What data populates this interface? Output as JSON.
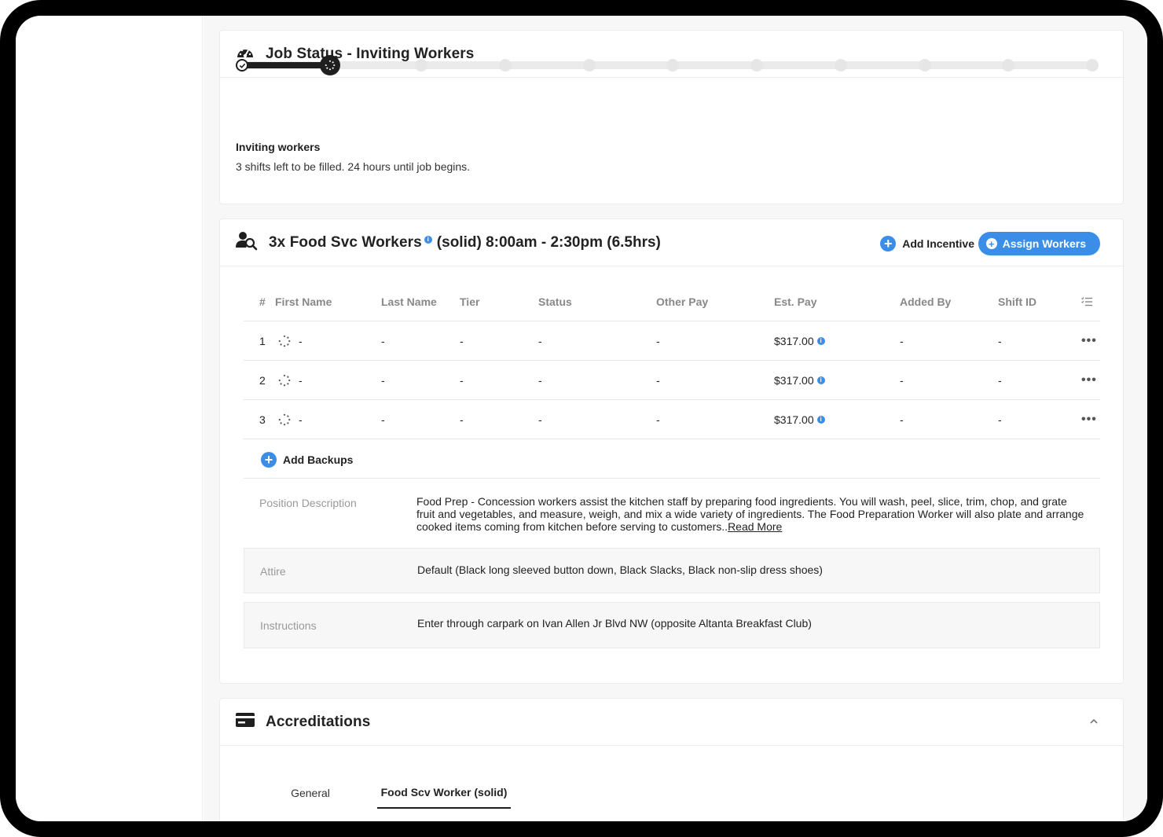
{
  "job_status": {
    "title": "Job Status - Inviting Workers",
    "heading": "Inviting workers",
    "text": "3 shifts left to be filled. 24 hours until job begins.",
    "steps_total": 11,
    "steps_completed": 1,
    "current_step": 2
  },
  "workers": {
    "title": "3x Food Svc Workers",
    "subtitle": "(solid) 8:00am - 2:30pm (6.5hrs)",
    "info": "i",
    "add_incentive_label": "Add Incentive",
    "assign_workers_label": "Assign Workers",
    "columns": [
      "#",
      "First Name",
      "Last Name",
      "Tier",
      "Status",
      "Other Pay",
      "Est. Pay",
      "Added By",
      "Shift ID"
    ],
    "rows": [
      {
        "num": "1",
        "first": "-",
        "last": "-",
        "tier": "-",
        "status": "-",
        "other": "-",
        "est": "$317.00",
        "added": "-",
        "shift": "-"
      },
      {
        "num": "2",
        "first": "-",
        "last": "-",
        "tier": "-",
        "status": "-",
        "other": "-",
        "est": "$317.00",
        "added": "-",
        "shift": "-"
      },
      {
        "num": "3",
        "first": "-",
        "last": "-",
        "tier": "-",
        "status": "-",
        "other": "-",
        "est": "$317.00",
        "added": "-",
        "shift": "-"
      }
    ],
    "more_label": "•••",
    "add_backups_label": "Add Backups",
    "position_label": "Position Description",
    "position_text": "Food Prep - Concession workers assist the kitchen staff by preparing food ingredients. You will wash, peel, slice, trim, chop, and grate fruit and vegetables, and measure, weigh, and mix a wide variety of ingredients. The Food Preparation Worker will also plate and arrange cooked items coming from kitchen before serving to customers..",
    "read_more_label": "Read More",
    "attire_label": "Attire",
    "attire_text": "Default (Black long sleeved button down, Black Slacks, Black non-slip dress shoes)",
    "instructions_label": "Instructions",
    "instructions_text": "Enter through carpark on Ivan Allen Jr Blvd NW (opposite Altanta Breakfast Club)"
  },
  "accreditations": {
    "title": "Accreditations",
    "tabs": [
      "General",
      "Food Scv Worker (solid)"
    ],
    "active_tab": "Food Scv Worker (solid)"
  },
  "colors": {
    "accent": "#3b8ee8",
    "dark": "#1f1f1f"
  }
}
